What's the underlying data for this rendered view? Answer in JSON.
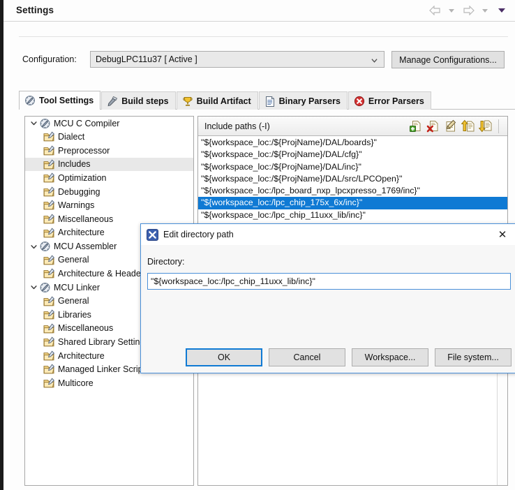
{
  "window": {
    "title": "Settings",
    "nav": {
      "back_icon": "back-arrow-icon",
      "back_menu_icon": "chevron-down-icon",
      "forward_icon": "forward-arrow-icon",
      "forward_menu_icon": "chevron-down-icon",
      "view_menu_icon": "chevron-down-icon"
    }
  },
  "config": {
    "label": "Configuration:",
    "value": "DebugLPC11u37  [ Active ]",
    "caret_icon": "chevron-down-icon",
    "manage_button": "Manage Configurations..."
  },
  "tabs": [
    {
      "label": "Tool Settings",
      "icon": "tool-settings-icon",
      "active": true
    },
    {
      "label": "Build steps",
      "icon": "build-steps-icon",
      "active": false
    },
    {
      "label": "Build Artifact",
      "icon": "build-artifact-icon",
      "active": false
    },
    {
      "label": "Binary Parsers",
      "icon": "binary-parsers-icon",
      "active": false
    },
    {
      "label": "Error Parsers",
      "icon": "error-parsers-icon",
      "active": false
    }
  ],
  "tree": [
    {
      "label": "MCU C Compiler",
      "level": 0,
      "expanded": true,
      "selected": false
    },
    {
      "label": "Dialect",
      "level": 1,
      "expanded": null,
      "selected": false
    },
    {
      "label": "Preprocessor",
      "level": 1,
      "expanded": null,
      "selected": false
    },
    {
      "label": "Includes",
      "level": 1,
      "expanded": null,
      "selected": true
    },
    {
      "label": "Optimization",
      "level": 1,
      "expanded": null,
      "selected": false
    },
    {
      "label": "Debugging",
      "level": 1,
      "expanded": null,
      "selected": false
    },
    {
      "label": "Warnings",
      "level": 1,
      "expanded": null,
      "selected": false
    },
    {
      "label": "Miscellaneous",
      "level": 1,
      "expanded": null,
      "selected": false
    },
    {
      "label": "Architecture",
      "level": 1,
      "expanded": null,
      "selected": false
    },
    {
      "label": "MCU Assembler",
      "level": 0,
      "expanded": true,
      "selected": false
    },
    {
      "label": "General",
      "level": 1,
      "expanded": null,
      "selected": false
    },
    {
      "label": "Architecture & Headers",
      "level": 1,
      "expanded": null,
      "selected": false
    },
    {
      "label": "MCU Linker",
      "level": 0,
      "expanded": true,
      "selected": false
    },
    {
      "label": "General",
      "level": 1,
      "expanded": null,
      "selected": false
    },
    {
      "label": "Libraries",
      "level": 1,
      "expanded": null,
      "selected": false
    },
    {
      "label": "Miscellaneous",
      "level": 1,
      "expanded": null,
      "selected": false
    },
    {
      "label": "Shared Library Settings",
      "level": 1,
      "expanded": null,
      "selected": false
    },
    {
      "label": "Architecture",
      "level": 1,
      "expanded": null,
      "selected": false
    },
    {
      "label": "Managed Linker Script",
      "level": 1,
      "expanded": null,
      "selected": false
    },
    {
      "label": "Multicore",
      "level": 1,
      "expanded": null,
      "selected": false
    }
  ],
  "include_paths": {
    "title": "Include paths (-I)",
    "toolbar": [
      {
        "name": "add-icon",
        "tooltip": "Add..."
      },
      {
        "name": "delete-icon",
        "tooltip": "Delete"
      },
      {
        "name": "edit-icon",
        "tooltip": "Edit..."
      },
      {
        "name": "move-up-icon",
        "tooltip": "Move Up"
      },
      {
        "name": "move-down-icon",
        "tooltip": "Move Down"
      }
    ],
    "items": [
      {
        "value": "\"${workspace_loc:/${ProjName}/DAL/boards}\"",
        "selected": false
      },
      {
        "value": "\"${workspace_loc:/${ProjName}/DAL/cfg}\"",
        "selected": false
      },
      {
        "value": "\"${workspace_loc:/${ProjName}/DAL/inc}\"",
        "selected": false
      },
      {
        "value": "\"${workspace_loc:/${ProjName}/DAL/src/LPCOpen}\"",
        "selected": false
      },
      {
        "value": "\"${workspace_loc:/lpc_board_nxp_lpcxpresso_1769/inc}\"",
        "selected": false
      },
      {
        "value": "\"${workspace_loc:/lpc_chip_175x_6x/inc}\"",
        "selected": true
      },
      {
        "value": "\"${workspace_loc:/lpc_chip_11uxx_lib/inc}\"",
        "selected": false
      }
    ]
  },
  "dialog": {
    "icon": "eclipse-x-icon",
    "title": "Edit directory path",
    "close_icon": "close-icon",
    "directory_label": "Directory:",
    "directory_value": "\"${workspace_loc:/lpc_chip_11uxx_lib/inc}\"",
    "buttons": [
      {
        "label": "OK",
        "default": true
      },
      {
        "label": "Cancel",
        "default": false
      },
      {
        "label": "Workspace...",
        "default": false
      },
      {
        "label": "File system...",
        "default": false
      }
    ]
  },
  "colors": {
    "selection_blue": "#0f7ad4",
    "focus_border": "#4a90d9",
    "panel_bg": "#f0f0f0",
    "tree_selected_bg": "#e8e8e8"
  }
}
